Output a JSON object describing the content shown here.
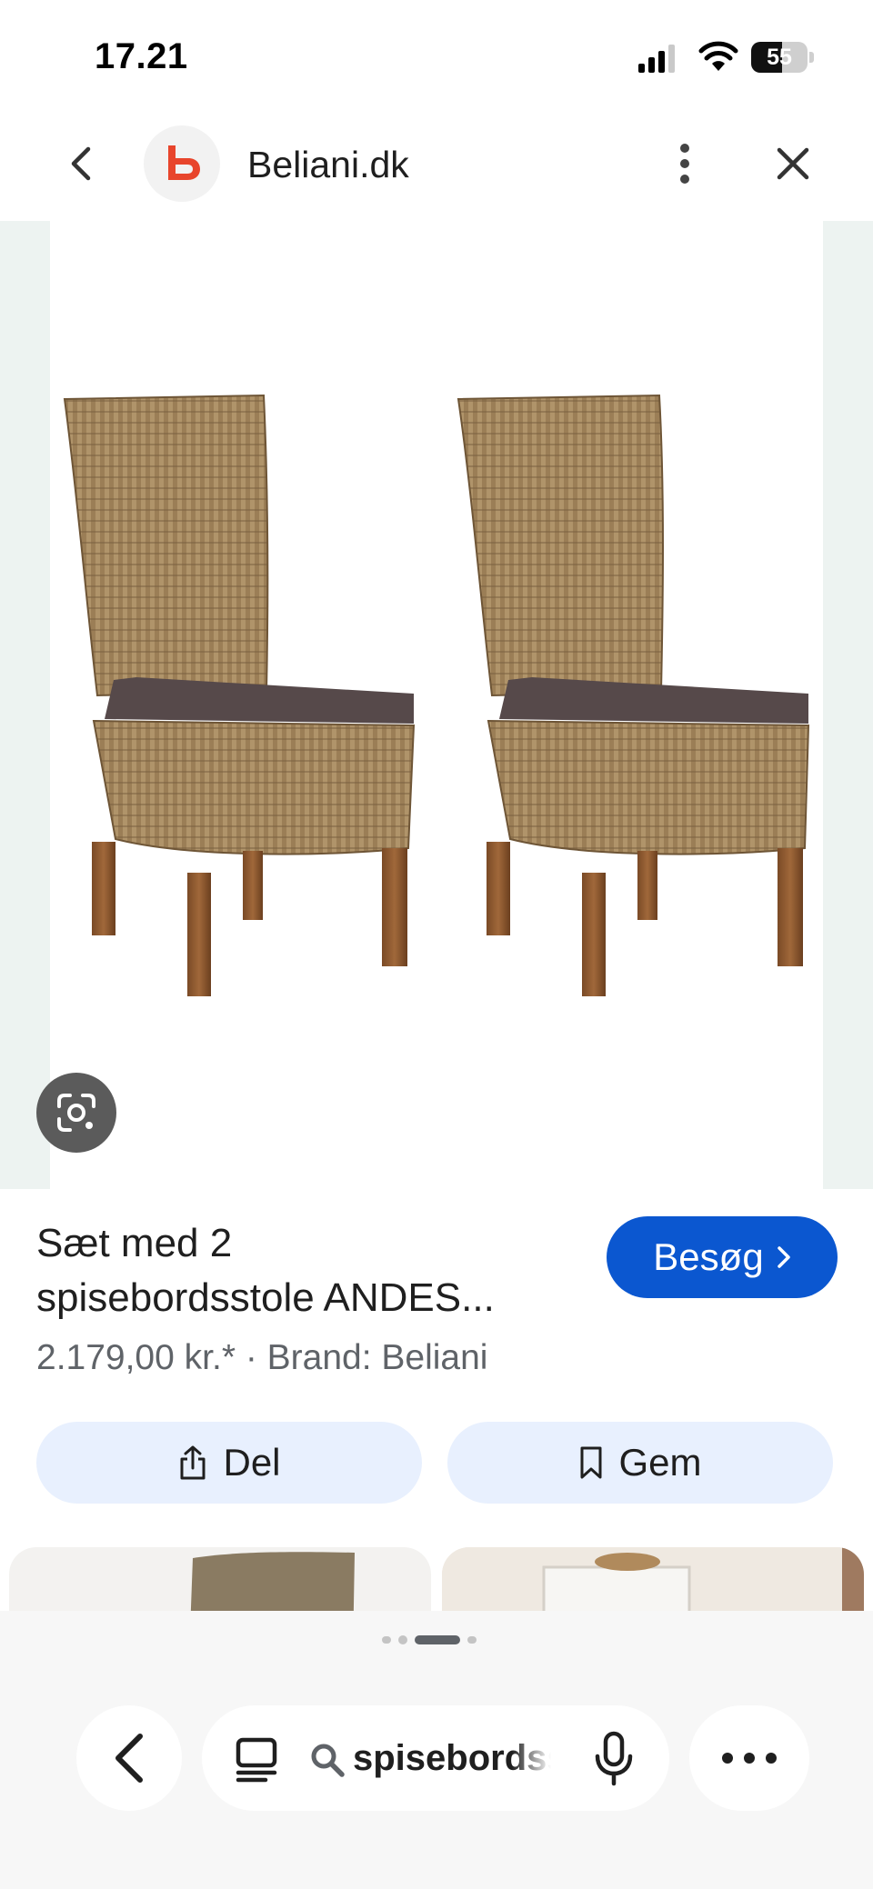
{
  "status_bar": {
    "time": "17.21",
    "battery_level": 55,
    "battery_text": "55",
    "icons": [
      "signal-icon",
      "wifi-icon",
      "battery-icon"
    ]
  },
  "header": {
    "site_name": "Beliani.dk",
    "logo_letter": "b",
    "brand_color": "#e8452c",
    "icons": [
      "back-arrow-icon",
      "more-vertical-icon",
      "close-icon"
    ]
  },
  "image": {
    "lens_icon": "google-lens-icon",
    "background": "#edf3f1"
  },
  "product": {
    "title_line1": "Sæt med 2",
    "title_line2": "spisebordsstole ANDES...",
    "price_line": "2.179,00 kr.* · Brand: Beliani"
  },
  "actions": {
    "visit_label": "Besøg",
    "share_label": "Del",
    "save_label": "Gem",
    "accent_color": "#0b57d0",
    "button_bg": "#e8f0fe"
  },
  "pagination": {
    "dots": 4,
    "active_index": 2
  },
  "bottom_bar": {
    "search_query": "spisebordsstole",
    "icons": [
      "back-chevron-icon",
      "tabs-icon",
      "search-icon",
      "mic-icon",
      "more-horizontal-icon"
    ]
  }
}
